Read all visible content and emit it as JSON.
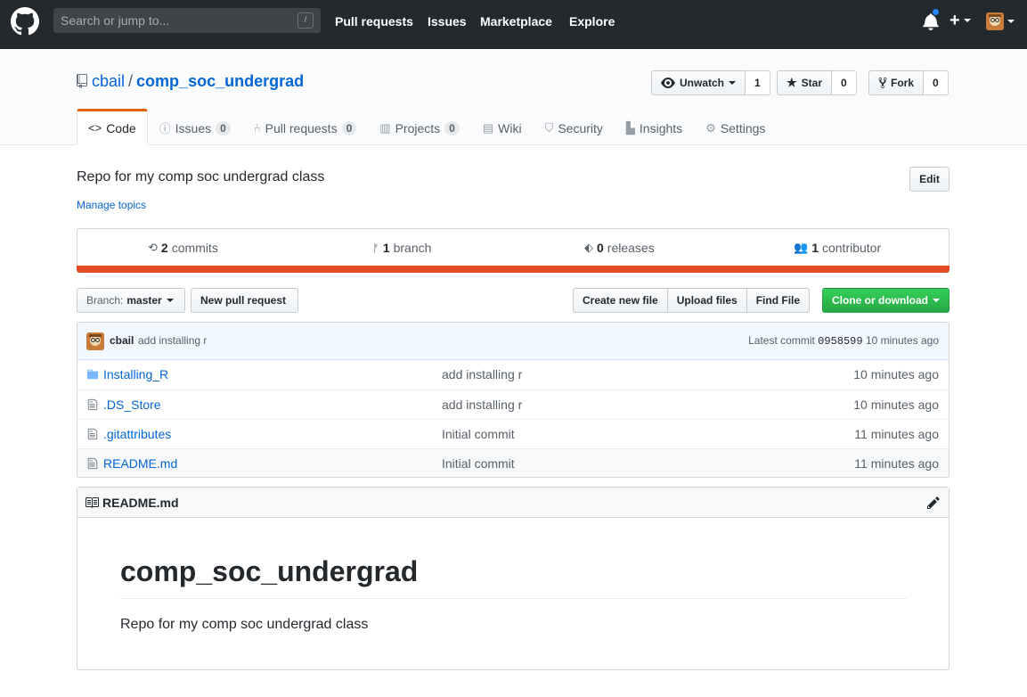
{
  "header": {
    "search_placeholder": "Search or jump to...",
    "slash_key": "/",
    "nav": [
      "Pull requests",
      "Issues",
      "Marketplace",
      "Explore"
    ],
    "plus": "+"
  },
  "repo": {
    "owner": "cbail",
    "separator": "/",
    "name": "comp_soc_undergrad",
    "actions": {
      "watch_label": "Unwatch",
      "watch_count": "1",
      "star_label": "Star",
      "star_count": "0",
      "fork_label": "Fork",
      "fork_count": "0"
    },
    "tabs": [
      {
        "label": "Code",
        "icon": "code-icon",
        "selected": true
      },
      {
        "label": "Issues",
        "count": "0",
        "icon": "issue-icon"
      },
      {
        "label": "Pull requests",
        "count": "0",
        "icon": "pull-request-icon"
      },
      {
        "label": "Projects",
        "count": "0",
        "icon": "project-icon"
      },
      {
        "label": "Wiki",
        "icon": "book-icon"
      },
      {
        "label": "Security",
        "icon": "shield-icon"
      },
      {
        "label": "Insights",
        "icon": "graph-icon"
      },
      {
        "label": "Settings",
        "icon": "gear-icon"
      }
    ],
    "description": "Repo for my comp soc undergrad class",
    "manage_topics": "Manage topics",
    "edit_label": "Edit"
  },
  "summary": {
    "commits_count": "2",
    "commits_label": "commits",
    "branch_count": "1",
    "branch_label": "branch",
    "releases_count": "0",
    "releases_label": "releases",
    "contributor_count": "1",
    "contributor_label": "contributor",
    "language_color": "#e34c26"
  },
  "filenav": {
    "branch_prefix": "Branch:",
    "branch_name": "master",
    "new_pr": "New pull request",
    "create_file": "Create new file",
    "upload_files": "Upload files",
    "find_file": "Find File",
    "clone": "Clone or download"
  },
  "commit": {
    "author": "cbail",
    "message": "add installing r",
    "latest_prefix": "Latest commit",
    "sha": "0958599",
    "age": "10 minutes ago"
  },
  "files": [
    {
      "name": "Installing_R",
      "type": "directory",
      "message": "add installing r",
      "age": "10 minutes ago"
    },
    {
      "name": ".DS_Store",
      "type": "file",
      "message": "add installing r",
      "age": "10 minutes ago"
    },
    {
      "name": ".gitattributes",
      "type": "file",
      "message": "Initial commit",
      "age": "11 minutes ago"
    },
    {
      "name": "README.md",
      "type": "file",
      "message": "Initial commit",
      "age": "11 minutes ago"
    }
  ],
  "readme": {
    "label": "README.md",
    "heading": "comp_soc_undergrad",
    "body": "Repo for my comp soc undergrad class"
  },
  "colors": {
    "header_bg": "#24292e",
    "link": "#0366d6",
    "clone_green": "#28a745",
    "tab_accent": "#e36209"
  }
}
